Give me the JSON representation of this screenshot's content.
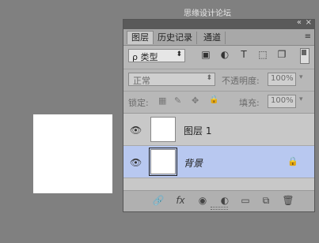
{
  "watermark": "思缘设计论坛 WWW.MISSYUAN.COM",
  "panel": {
    "collapse_icon": "«",
    "close_icon": "×",
    "tabs": [
      {
        "label": "图层",
        "active": true
      },
      {
        "label": "历史记录",
        "active": false
      },
      {
        "label": "通道",
        "active": false
      }
    ],
    "menu_icon": "≡"
  },
  "filter": {
    "label": "ρ 类型",
    "icons": [
      "image-filter-icon",
      "adjustment-filter-icon",
      "text-filter-icon",
      "shape-filter-icon",
      "smart-object-filter-icon"
    ],
    "icon_glyphs": [
      "▣",
      "◐",
      "T",
      "⬚",
      "❐"
    ]
  },
  "blend": {
    "mode": "正常",
    "opacity_label": "不透明度:",
    "opacity_value": "100%"
  },
  "lock": {
    "label": "锁定:",
    "fill_label": "填充:",
    "fill_value": "100%",
    "icon_glyphs": [
      "▦",
      "✎",
      "✥",
      "🔒"
    ]
  },
  "layers": [
    {
      "name": "图层 1",
      "visible": true,
      "selected": false,
      "locked": false
    },
    {
      "name": "背景",
      "visible": true,
      "selected": true,
      "locked": true
    }
  ],
  "bottom_icons": [
    "🔗",
    "fx",
    "◉",
    "◐",
    "▭",
    "⧉",
    "🗑"
  ]
}
